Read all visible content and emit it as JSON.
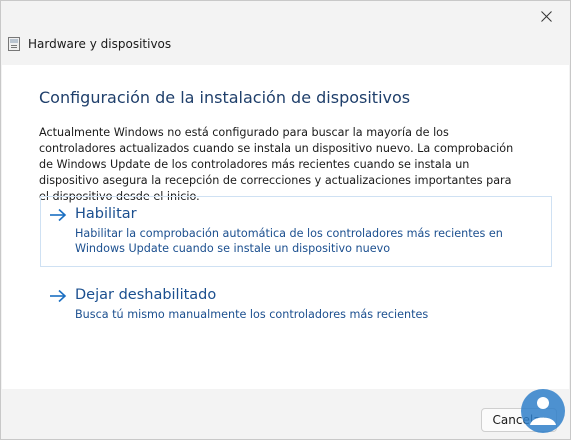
{
  "window": {
    "title": "Hardware y dispositivos",
    "close_icon": "close-icon"
  },
  "main": {
    "heading": "Configuración de la instalación de dispositivos",
    "description": "Actualmente Windows no está configurado para buscar la mayoría de los controladores actualizados cuando se instala un dispositivo nuevo. La comprobación de Windows Update de los controladores más recientes cuando se instala un dispositivo asegura la recepción de correcciones y actualizaciones importantes para el dispositivo desde el inicio.",
    "options": [
      {
        "title": "Habilitar",
        "description": "Habilitar la comprobación automática de los controladores más recientes en Windows Update cuando se instale un dispositivo nuevo",
        "icon": "arrow-right-icon"
      },
      {
        "title": "Dejar deshabilitado",
        "description": "Busca tú mismo manualmente los controladores más recientes",
        "icon": "arrow-right-icon"
      }
    ]
  },
  "footer": {
    "cancel_label": "Cancelar"
  },
  "colors": {
    "accent": "#1b4f8f",
    "heading": "#1f3f6b",
    "watermark": "#2f7fc9"
  }
}
